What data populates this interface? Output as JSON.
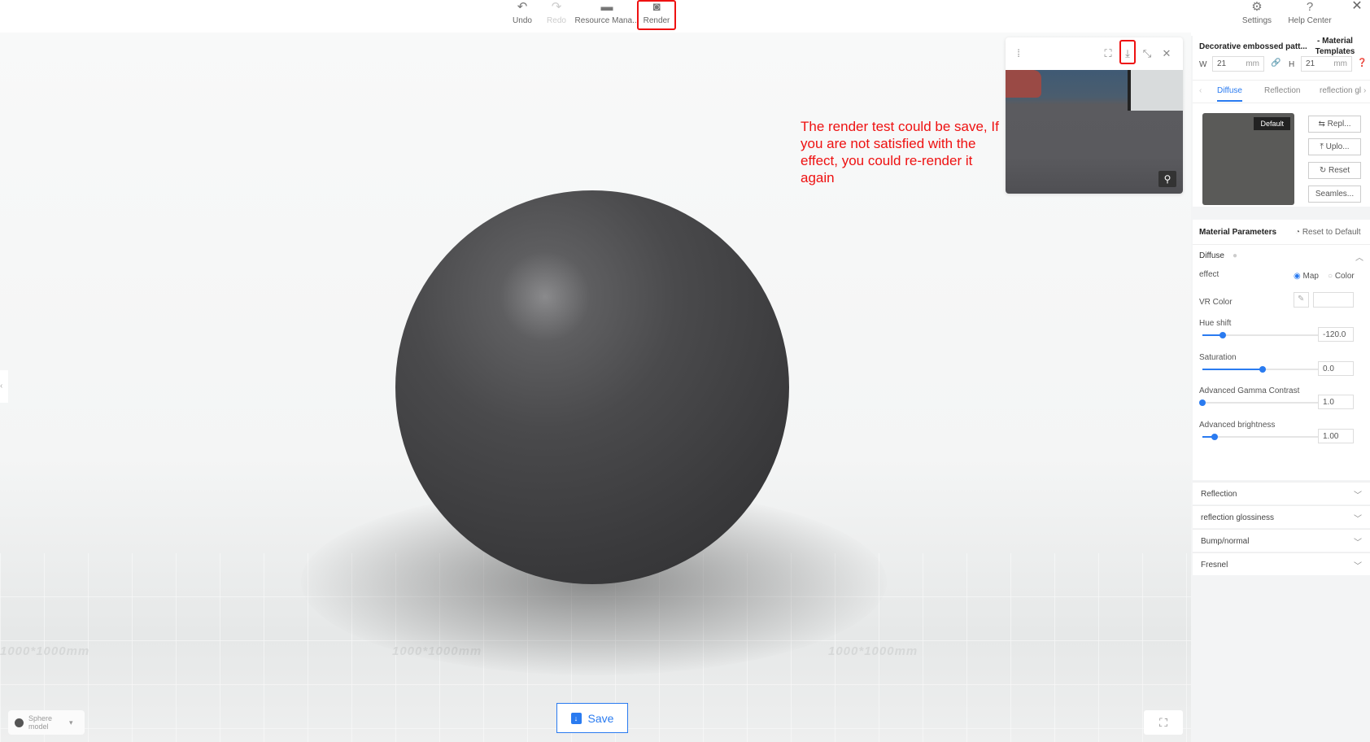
{
  "toolbar": {
    "undo": "Undo",
    "redo": "Redo",
    "resource": "Resource Mana...",
    "render": "Render",
    "settings": "Settings",
    "help": "Help Center"
  },
  "viewport": {
    "annotation": "The render test could be save, If you are not satisfied with the effect, you could re-render it again",
    "floor_labels": [
      "1000*1000mm",
      "1000*1000mm",
      "1000*1000mm"
    ],
    "save_label": "Save",
    "model_select": "Sphere model"
  },
  "panel": {
    "title": "Decorative embossed patt...",
    "subtitle": "- Material Templates",
    "w_label": "W",
    "w_value": "21",
    "h_label": "H",
    "h_value": "21",
    "unit": "mm",
    "tabs": [
      "Diffuse",
      "Reflection",
      "reflection gl"
    ],
    "texture_badge": "Default",
    "buttons": [
      "Repl...",
      "Uplo...",
      "Reset",
      "Seamles..."
    ],
    "params_title": "Material Parameters",
    "reset_default": "Reset to Default",
    "diffuse": {
      "title": "Diffuse",
      "effect_label": "effect",
      "effect_options": [
        "Map",
        "Color"
      ],
      "effect_selected": "Map",
      "vr_color": "VR Color",
      "sliders": [
        {
          "label": "Hue shift",
          "value": "-120.0",
          "fraction": 0.17
        },
        {
          "label": "Saturation",
          "value": "0.0",
          "fraction": 0.5
        },
        {
          "label": "Advanced Gamma Contrast",
          "value": "1.0",
          "fraction": 0.0
        },
        {
          "label": "Advanced brightness",
          "value": "1.00",
          "fraction": 0.1
        }
      ]
    },
    "sections": [
      "Reflection",
      "reflection glossiness",
      "Bump/normal",
      "Fresnel"
    ]
  }
}
